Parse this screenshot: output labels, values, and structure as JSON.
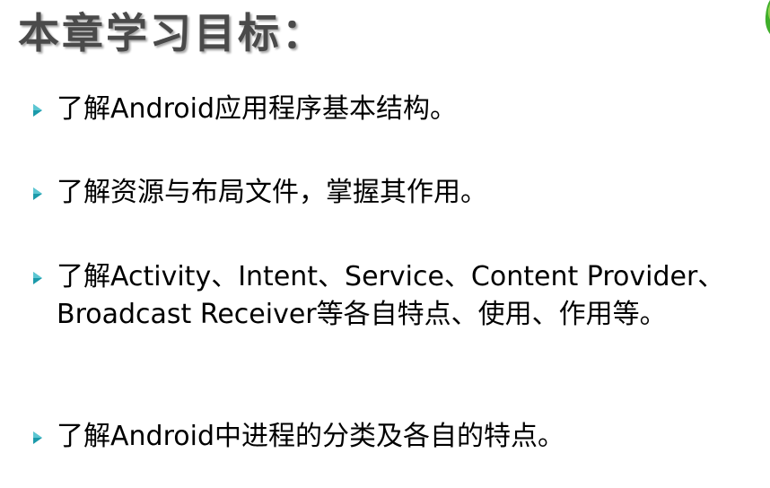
{
  "slide": {
    "title": "本章学习目标：",
    "bullets": [
      "了解Android应用程序基本结构。",
      "了解资源与布局文件，掌握其作用。",
      "了解Activity、Intent、Service、Content Provider、Broadcast Receiver等各自特点、使用、作用等。",
      "了解Android中进程的分类及各自的特点。"
    ]
  },
  "colors": {
    "title_text": "#4a4a4a",
    "title_shadow": "#a9a9a9",
    "bullet_marker": "#1b9aaa",
    "corner_accent": "#3fae2a"
  },
  "icons": {
    "bullet": "triangle-right-icon",
    "corner": "leaf-decoration-icon"
  }
}
